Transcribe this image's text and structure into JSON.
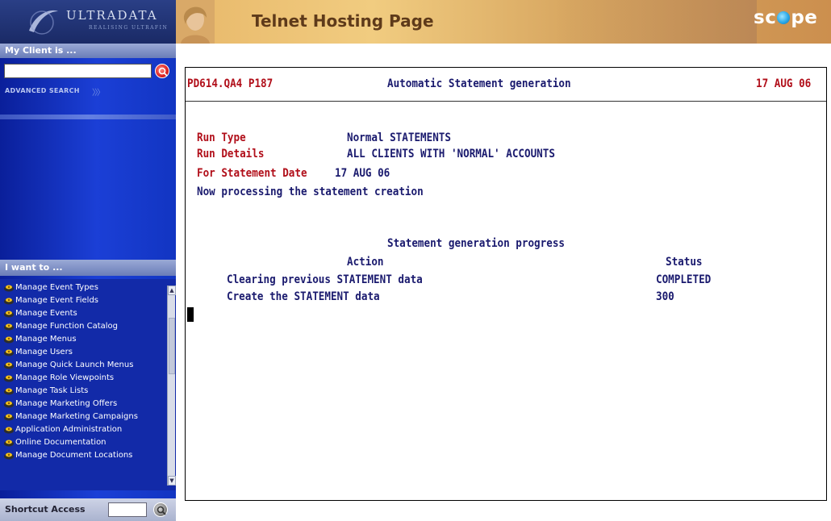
{
  "sidebar": {
    "logo_text": "ULTRADATA",
    "logo_tagline": "REALISING ULTRAFIN",
    "client_heading": "My Client is ...",
    "client_search_value": "",
    "advanced_search": "ADVANCED SEARCH",
    "want_heading": "I want to ...",
    "menu_items": [
      {
        "label": "Manage Event Types",
        "icon": "gear-key-icon"
      },
      {
        "label": "Manage Event Fields",
        "icon": "gear-key-icon"
      },
      {
        "label": "Manage Events",
        "icon": "gear-key-icon"
      },
      {
        "label": "Manage Function Catalog",
        "icon": "gear-key-icon"
      },
      {
        "label": "Manage Menus",
        "icon": "gear-key-icon"
      },
      {
        "label": "Manage Users",
        "icon": "gear-key-icon"
      },
      {
        "label": "Manage Quick Launch Menus",
        "icon": "gear-key-icon"
      },
      {
        "label": "Manage Role Viewpoints",
        "icon": "gear-key-icon"
      },
      {
        "label": "Manage Task Lists",
        "icon": "gear-key-icon"
      },
      {
        "label": "Manage Marketing Offers",
        "icon": "gear-key-icon"
      },
      {
        "label": "Manage Marketing Campaigns",
        "icon": "gear-key-icon"
      },
      {
        "label": "Application Administration",
        "icon": "gear-key-icon"
      },
      {
        "label": "Online Documentation",
        "icon": "gear-key-icon"
      },
      {
        "label": "Manage Document Locations",
        "icon": "gear-key-icon"
      }
    ],
    "shortcut_label": "Shortcut Access",
    "shortcut_value": ""
  },
  "header": {
    "title": "Telnet Hosting Page",
    "brand_left": "sc",
    "brand_right": "pe"
  },
  "terminal": {
    "program_id": "PD614.QA4 P187",
    "screen_title": "Automatic Statement generation",
    "date": "17 AUG 06",
    "run_type_label": "Run Type",
    "run_type_value": "Normal STATEMENTS",
    "run_details_label": "Run Details",
    "run_details_value": "ALL CLIENTS WITH 'NORMAL' ACCOUNTS",
    "statement_date_label": "For Statement Date",
    "statement_date_value": "17 AUG 06",
    "processing_message": "Now processing the statement creation",
    "progress_title": "Statement generation progress",
    "col_action": "Action",
    "col_status": "Status",
    "rows": [
      {
        "action": "Clearing previous STATEMENT data",
        "status": "COMPLETED"
      },
      {
        "action": "Create the STATEMENT data",
        "status": "300"
      }
    ]
  },
  "colors": {
    "terminal_red": "#b10f1a",
    "terminal_navy": "#1a1a6e",
    "sidebar_blue": "#1b3fd6",
    "header_gold": "#f1cc80"
  }
}
